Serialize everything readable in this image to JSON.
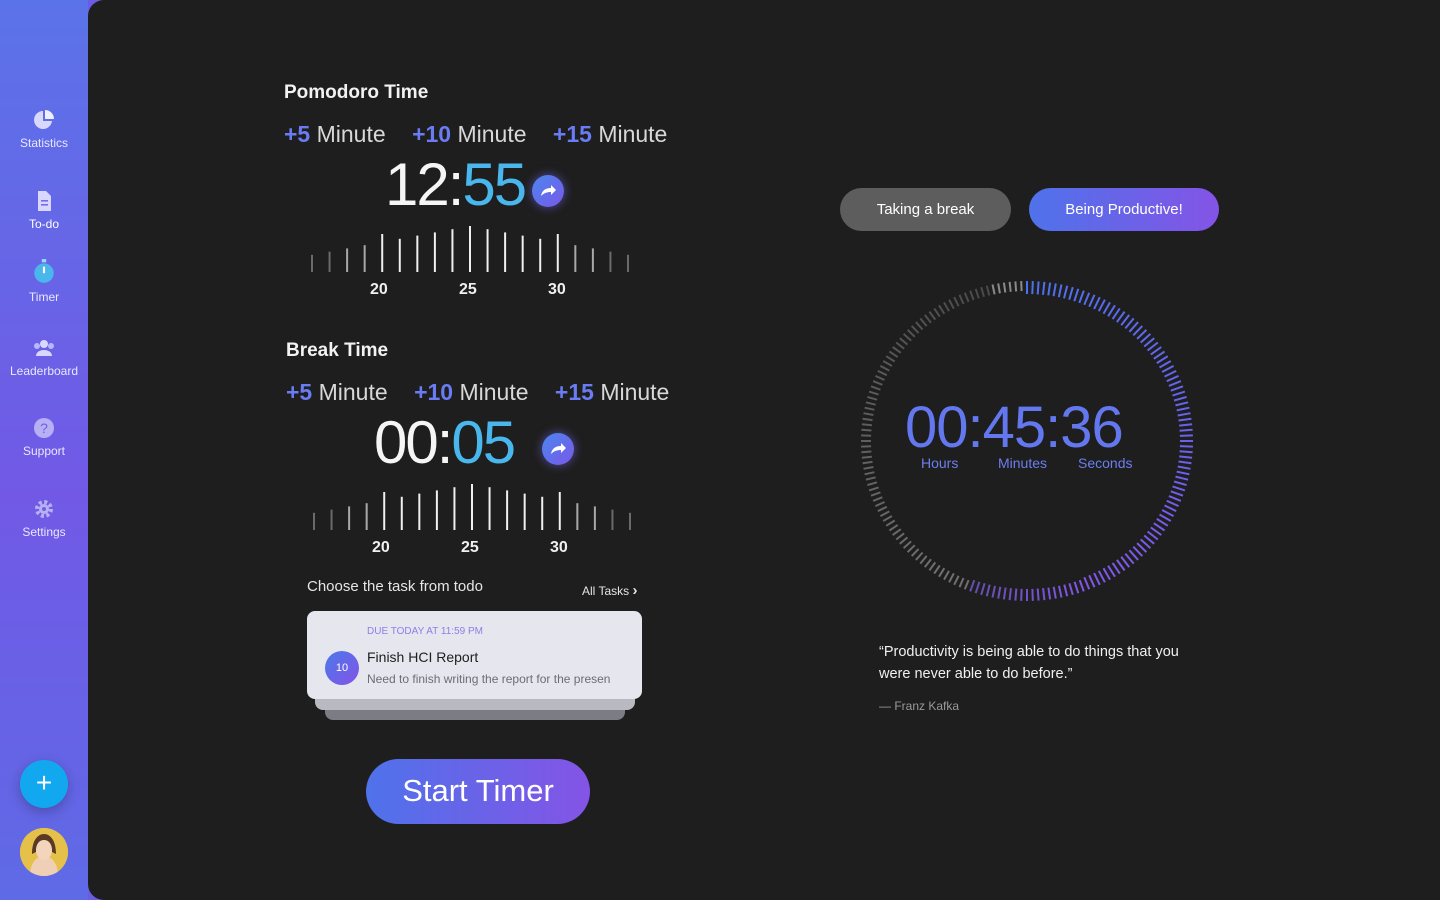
{
  "sidebar": {
    "items": [
      {
        "label": "Statistics",
        "icon": "pie-chart-icon"
      },
      {
        "label": "To-do",
        "icon": "document-icon"
      },
      {
        "label": "Timer",
        "icon": "stopwatch-icon"
      },
      {
        "label": "Leaderboard",
        "icon": "group-icon"
      },
      {
        "label": "Support",
        "icon": "question-icon"
      },
      {
        "label": "Settings",
        "icon": "gear-icon"
      }
    ],
    "active": "To-do",
    "fab_label": "+"
  },
  "pomodoro": {
    "title": "Pomodoro Time",
    "increments": [
      {
        "amount": "+5",
        "unit": "Minute"
      },
      {
        "amount": "+10",
        "unit": "Minute"
      },
      {
        "amount": "+15",
        "unit": "Minute"
      }
    ],
    "time_main": "12:",
    "time_sec": "55",
    "ruler_labels": [
      "20",
      "25",
      "30"
    ]
  },
  "break": {
    "title": "Break Time",
    "increments": [
      {
        "amount": "+5",
        "unit": "Minute"
      },
      {
        "amount": "+10",
        "unit": "Minute"
      },
      {
        "amount": "+15",
        "unit": "Minute"
      }
    ],
    "time_main": "00:",
    "time_sec": "05",
    "ruler_labels": [
      "20",
      "25",
      "30"
    ]
  },
  "tasks": {
    "prompt": "Choose the task from todo",
    "all_tasks": "All Tasks",
    "card": {
      "due": "DUE TODAY AT 11:59 PM",
      "badge": "10",
      "title": "Finish HCI Report",
      "description": "Need to finish writing the report for the presen"
    }
  },
  "start_button": "Start Timer",
  "mode": {
    "break_label": "Taking a break",
    "productive_label": "Being Productive!",
    "selected": "Being Productive!"
  },
  "clock": {
    "display": "00:45:36",
    "hours_label": "Hours",
    "minutes_label": "Minutes",
    "seconds_label": "Seconds"
  },
  "quote": {
    "text": "“Productivity is being able to do things that you were never able to do before.”",
    "author": "— Franz Kafka"
  },
  "colors": {
    "accent_blue": "#4f72ea",
    "accent_purple": "#8454e6",
    "seconds_cyan": "#49b6ec",
    "background": "#1e1e1e"
  }
}
